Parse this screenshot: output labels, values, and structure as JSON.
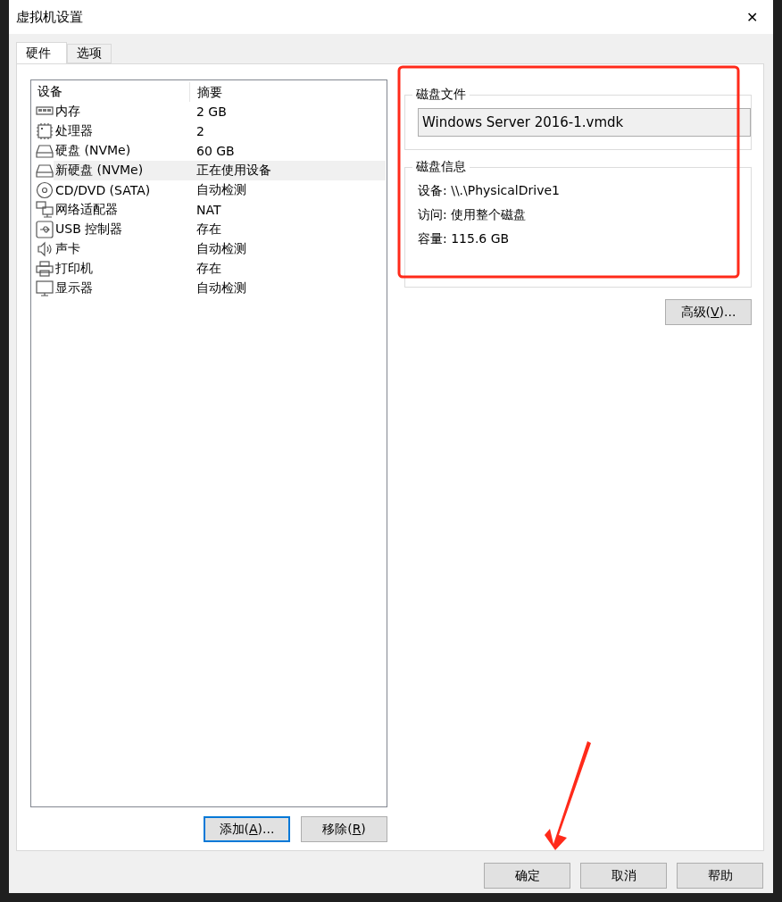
{
  "window": {
    "title": "虚拟机设置",
    "close": "✕"
  },
  "tabs": [
    {
      "label": "硬件",
      "selected": true
    },
    {
      "label": "选项",
      "selected": false
    }
  ],
  "device_list": {
    "columns": [
      "设备",
      "摘要"
    ],
    "rows": [
      {
        "kind": "memory",
        "device": "内存",
        "summary": "2 GB",
        "selected": false
      },
      {
        "kind": "cpu",
        "device": "处理器",
        "summary": "2",
        "selected": false
      },
      {
        "kind": "disk",
        "device": "硬盘 (NVMe)",
        "summary": "60 GB",
        "selected": false
      },
      {
        "kind": "disk",
        "device": "新硬盘 (NVMe)",
        "summary": "正在使用设备",
        "selected": true
      },
      {
        "kind": "cdrom",
        "device": "CD/DVD (SATA)",
        "summary": "自动检测",
        "selected": false
      },
      {
        "kind": "network",
        "device": "网络适配器",
        "summary": "NAT",
        "selected": false
      },
      {
        "kind": "usb",
        "device": "USB 控制器",
        "summary": "存在",
        "selected": false
      },
      {
        "kind": "sound",
        "device": "声卡",
        "summary": "自动检测",
        "selected": false
      },
      {
        "kind": "printer",
        "device": "打印机",
        "summary": "存在",
        "selected": false
      },
      {
        "kind": "display",
        "device": "显示器",
        "summary": "自动检测",
        "selected": false
      }
    ]
  },
  "list_buttons": [
    {
      "label_start": "添加(",
      "access_key": "A",
      "label_end": ")...",
      "focused": true
    },
    {
      "label_start": "移除(",
      "access_key": "R",
      "label_end": ")",
      "focused": false
    }
  ],
  "disk_file": {
    "title": "磁盘文件",
    "value": "Windows Server 2016-1.vmdk"
  },
  "disk_info": {
    "title": "磁盘信息",
    "lines": [
      {
        "label": "设备:",
        "value": "\\\\.\\PhysicalDrive1"
      },
      {
        "label": "访问:",
        "value": "使用整个磁盘"
      },
      {
        "label": "容量:",
        "value": "115.6 GB"
      }
    ]
  },
  "advanced_button": {
    "label_start": "高级(",
    "access_key": "V",
    "label_end": ")..."
  },
  "dialog_buttons": [
    {
      "label": "确定"
    },
    {
      "label": "取消"
    },
    {
      "label": "帮助"
    }
  ]
}
